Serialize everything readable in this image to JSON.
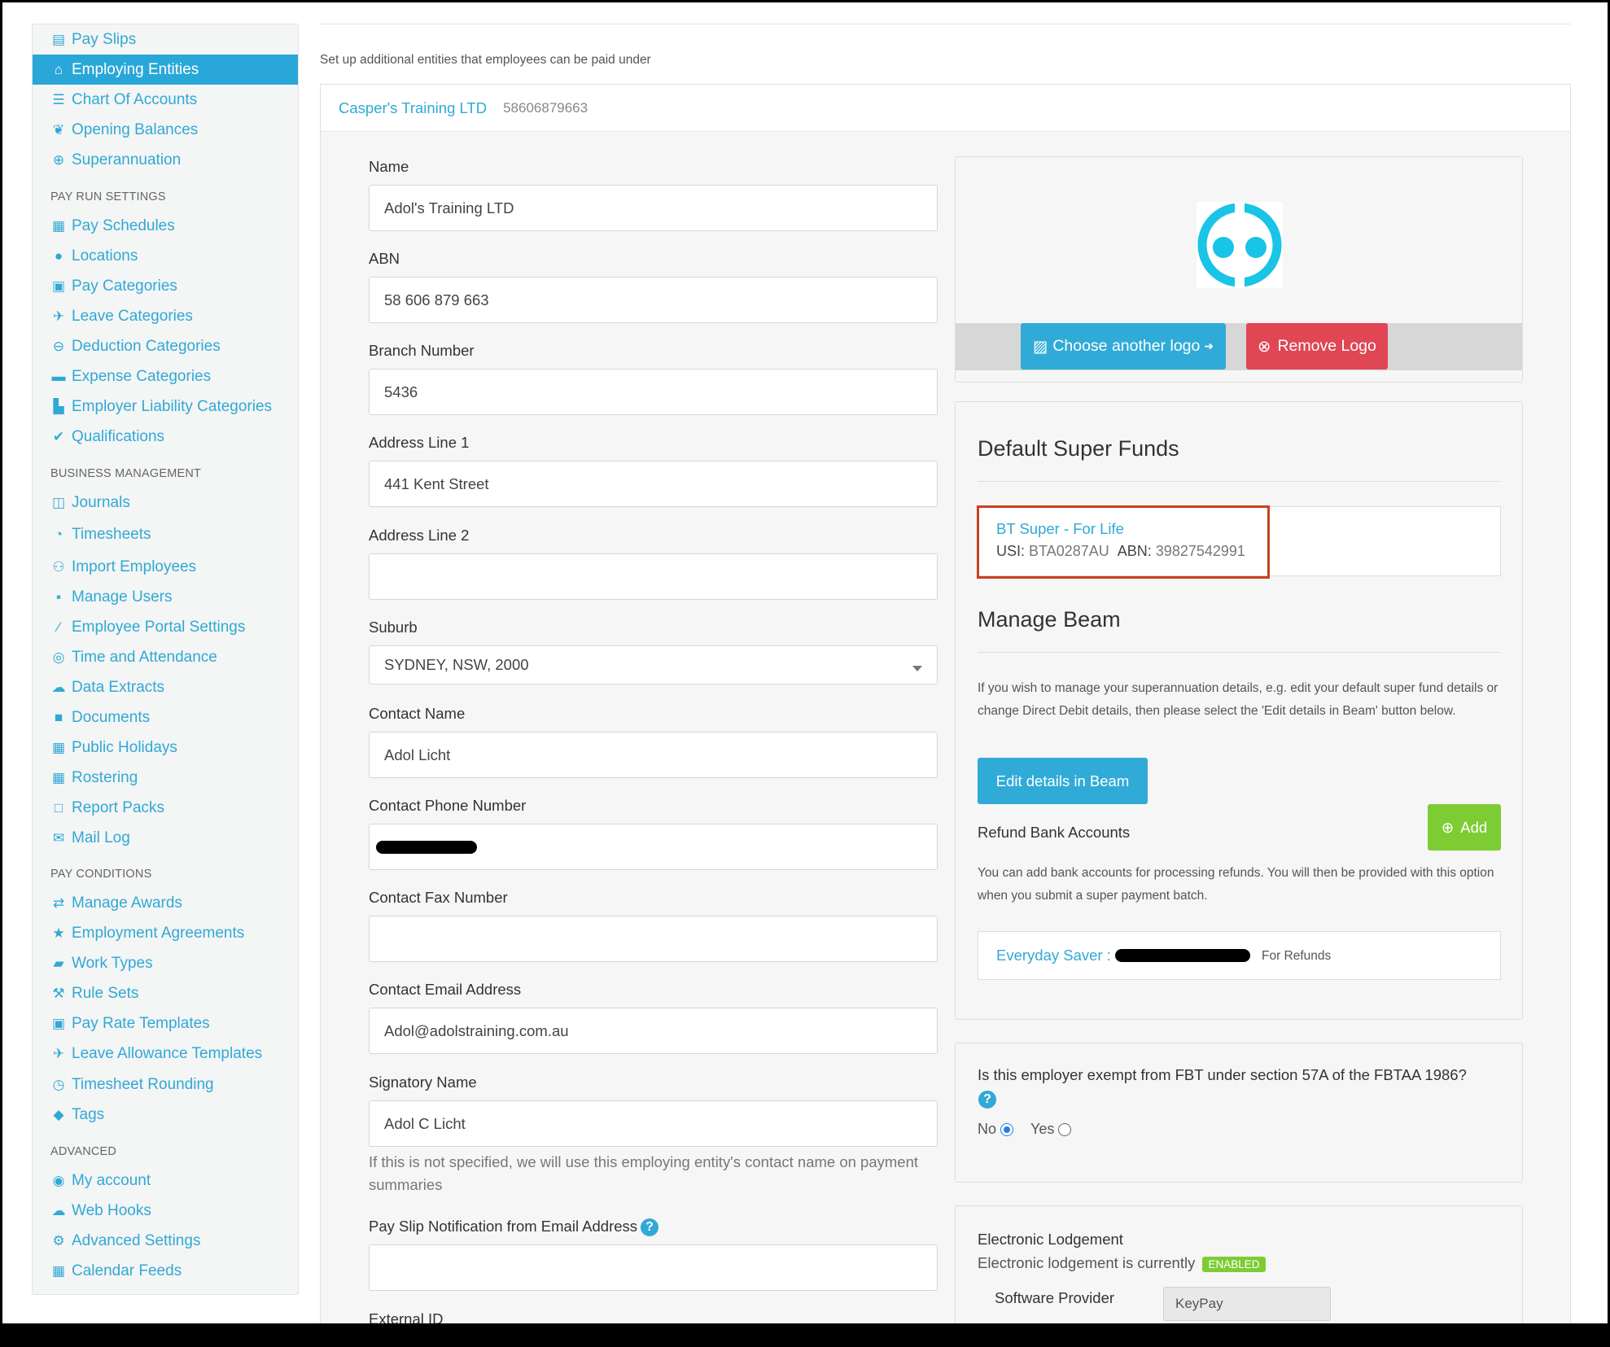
{
  "sidebar": {
    "items_top": [
      {
        "label": "Pay Slips",
        "icon": "file-icon"
      },
      {
        "label": "Employing Entities",
        "icon": "bank-icon",
        "active": true
      },
      {
        "label": "Chart Of Accounts",
        "icon": "list-icon"
      },
      {
        "label": "Opening Balances",
        "icon": "leaf-icon"
      },
      {
        "label": "Superannuation",
        "icon": "lifebuoy-icon"
      }
    ],
    "pay_run_heading": "PAY RUN SETTINGS",
    "pay_run_items": [
      {
        "label": "Pay Schedules",
        "icon": "calendar-icon"
      },
      {
        "label": "Locations",
        "icon": "globe-icon"
      },
      {
        "label": "Pay Categories",
        "icon": "money-icon"
      },
      {
        "label": "Leave Categories",
        "icon": "plane-icon"
      },
      {
        "label": "Deduction Categories",
        "icon": "minus-circle-icon"
      },
      {
        "label": "Expense Categories",
        "icon": "archive-icon"
      },
      {
        "label": "Employer Liability Categories",
        "icon": "factory-icon"
      },
      {
        "label": "Qualifications",
        "icon": "check-icon"
      }
    ],
    "business_heading": "BUSINESS MANAGEMENT",
    "business_items": [
      {
        "label": "Journals",
        "icon": "book-icon"
      },
      {
        "label": "Timesheets",
        "icon": "clock-icon"
      },
      {
        "label": "Import Employees",
        "icon": "people-icon"
      },
      {
        "label": "Manage Users",
        "icon": "lock-icon"
      },
      {
        "label": "Employee Portal Settings",
        "icon": "magic-wand-icon"
      },
      {
        "label": "Time and Attendance",
        "icon": "user-clock-icon"
      },
      {
        "label": "Data Extracts",
        "icon": "cloud-download-icon"
      },
      {
        "label": "Documents",
        "icon": "folder-icon"
      },
      {
        "label": "Public Holidays",
        "icon": "calendar-icon"
      },
      {
        "label": "Rostering",
        "icon": "calendar-grid-icon"
      },
      {
        "label": "Report Packs",
        "icon": "folder-open-icon"
      },
      {
        "label": "Mail Log",
        "icon": "envelope-icon"
      }
    ],
    "conditions_heading": "PAY CONDITIONS",
    "conditions_items": [
      {
        "label": "Manage Awards",
        "icon": "exchange-icon"
      },
      {
        "label": "Employment Agreements",
        "icon": "star-icon"
      },
      {
        "label": "Work Types",
        "icon": "book-icon"
      },
      {
        "label": "Rule Sets",
        "icon": "gavel-icon"
      },
      {
        "label": "Pay Rate Templates",
        "icon": "money-icon"
      },
      {
        "label": "Leave Allowance Templates",
        "icon": "plane-icon"
      },
      {
        "label": "Timesheet Rounding",
        "icon": "clock-icon"
      },
      {
        "label": "Tags",
        "icon": "tag-icon"
      }
    ],
    "advanced_heading": "ADVANCED",
    "advanced_items": [
      {
        "label": "My account",
        "icon": "user-circle-icon"
      },
      {
        "label": "Web Hooks",
        "icon": "cloud-icon"
      },
      {
        "label": "Advanced Settings",
        "icon": "gear-icon"
      },
      {
        "label": "Calendar Feeds",
        "icon": "calendar-icon"
      }
    ]
  },
  "main": {
    "intro": "Set up additional entities that employees can be paid under",
    "entity_name": "Casper's Training LTD",
    "entity_abn": "58606879663",
    "form": {
      "name_label": "Name",
      "name_value": "Adol's Training LTD",
      "abn_label": "ABN",
      "abn_value": "58 606 879 663",
      "branch_label": "Branch Number",
      "branch_value": "5436",
      "addr1_label": "Address Line 1",
      "addr1_value": "441 Kent Street",
      "addr2_label": "Address Line 2",
      "addr2_value": "",
      "suburb_label": "Suburb",
      "suburb_value": "SYDNEY, NSW, 2000",
      "contact_name_label": "Contact Name",
      "contact_name_value": "Adol Licht",
      "phone_label": "Contact Phone Number",
      "fax_label": "Contact Fax Number",
      "fax_value": "",
      "email_label": "Contact Email Address",
      "email_value": "Adol@adolstraining.com.au",
      "signatory_label": "Signatory Name",
      "signatory_value": "Adol C Licht",
      "signatory_help": "If this is not specified, we will use this employing entity's contact name on payment summaries",
      "payslip_email_label": "Pay Slip Notification from Email Address",
      "payslip_email_value": "",
      "external_id_label": "External ID"
    },
    "logo": {
      "choose_label": "Choose another logo",
      "remove_label": "Remove Logo"
    },
    "super": {
      "heading": "Default Super Funds",
      "fund_name": "BT Super - For Life",
      "usi_label": "USI:",
      "usi_value": "BTA0287AU",
      "abn_label": "ABN:",
      "abn_value": "39827542991",
      "beam_heading": "Manage Beam",
      "beam_text": "If you wish to manage your superannuation details, e.g. edit your default super fund details or change Direct Debit details, then please select the 'Edit details in Beam' button below.",
      "beam_button": "Edit details in Beam",
      "refund_heading": "Refund Bank Accounts",
      "add_button": "Add",
      "refund_text": "You can add bank accounts for processing refunds. You will then be provided with this option when you submit a super payment batch.",
      "account_name": "Everyday Saver :",
      "account_tag": "For Refunds"
    },
    "fbt": {
      "question": "Is this employer exempt from FBT under section 57A of the FBTAA 1986?",
      "no_label": "No",
      "yes_label": "Yes",
      "selected": "No"
    },
    "lodgement": {
      "heading": "Electronic Lodgement",
      "status_text": "Electronic lodgement is currently",
      "status_badge": "ENABLED",
      "provider_label": "Software Provider",
      "provider_value": "KeyPay"
    }
  },
  "colors": {
    "accent": "#30a9d6",
    "danger": "#e04654",
    "success": "#7dcc34",
    "highlight_border": "#c8411f"
  }
}
